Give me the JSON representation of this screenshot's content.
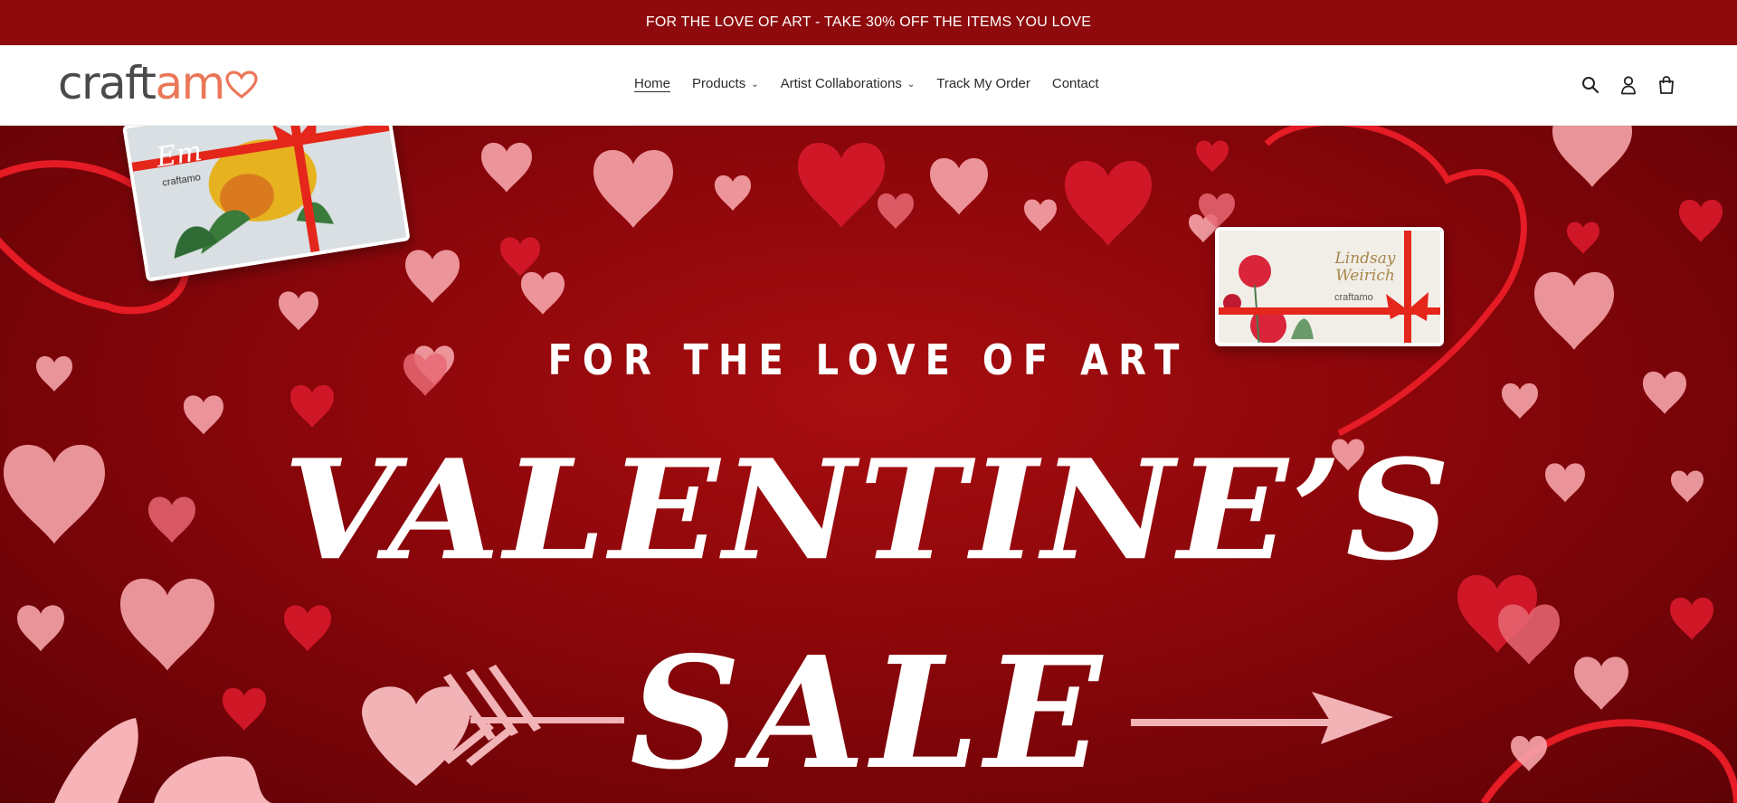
{
  "announcement": {
    "text": "FOR THE LOVE OF ART - TAKE 30% OFF THE ITEMS YOU LOVE"
  },
  "header": {
    "logo": {
      "craft": "craft",
      "amo": "am"
    },
    "nav": [
      {
        "label": "Home",
        "active": true,
        "dropdown": false
      },
      {
        "label": "Products",
        "active": false,
        "dropdown": true
      },
      {
        "label": "Artist Collaborations",
        "active": false,
        "dropdown": true
      },
      {
        "label": "Track My Order",
        "active": false,
        "dropdown": false
      },
      {
        "label": "Contact",
        "active": false,
        "dropdown": false
      }
    ],
    "icons": [
      "search-icon",
      "account-icon",
      "cart-icon"
    ]
  },
  "hero": {
    "subtitle": "FOR THE LOVE OF ART",
    "title": "VALENTINE’S",
    "title2": "SALE",
    "card_left_signature": "Em",
    "card_left_brand": "craftamo",
    "card_right_signature": "Lindsay Weirich",
    "card_right_brand": "craftamo"
  },
  "colors": {
    "announcement_bg": "#8e0a0c",
    "hero_bg": "#8a060a",
    "logo_accent": "#ea7758",
    "ribbon": "#e5261b"
  }
}
